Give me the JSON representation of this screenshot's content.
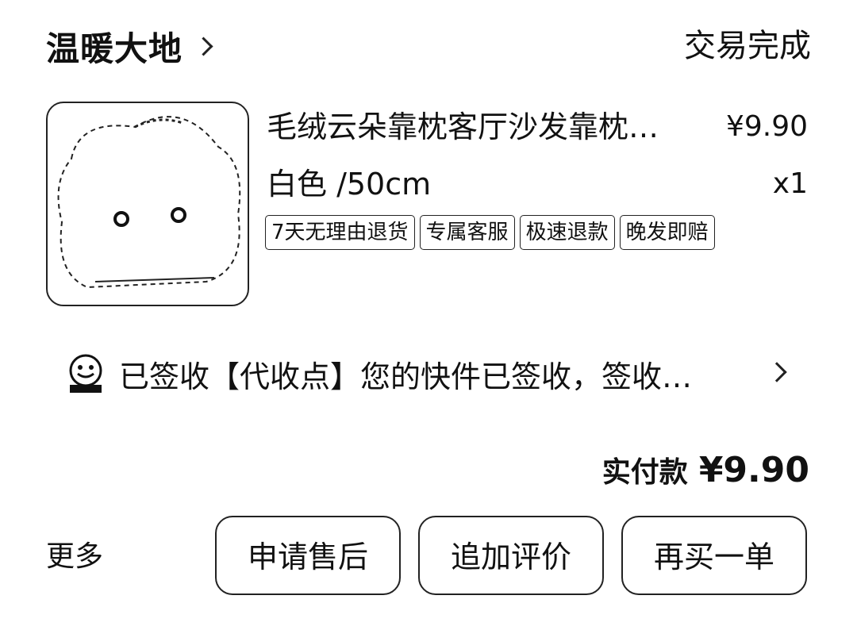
{
  "order": {
    "shop_name": "温暖大地",
    "status": "交易完成"
  },
  "item": {
    "thumbnail": "pillow-thumbnail-icon",
    "title": "毛绒云朵靠枕客厅沙发靠枕…",
    "price": "¥9.90",
    "spec": "白色 /50cm",
    "quantity": "x1",
    "tags": [
      "7天无理由退货",
      "专属客服",
      "极速退款",
      "晚发即赔"
    ]
  },
  "logistics": {
    "icon": "pickup-station-icon",
    "text": "已签收【代收点】您的快件已签收，签收…"
  },
  "payment": {
    "label": "实付款",
    "amount": "¥9.90"
  },
  "actions": {
    "more_label": "更多",
    "buttons": [
      "申请售后",
      "追加评价",
      "再买一单"
    ]
  }
}
